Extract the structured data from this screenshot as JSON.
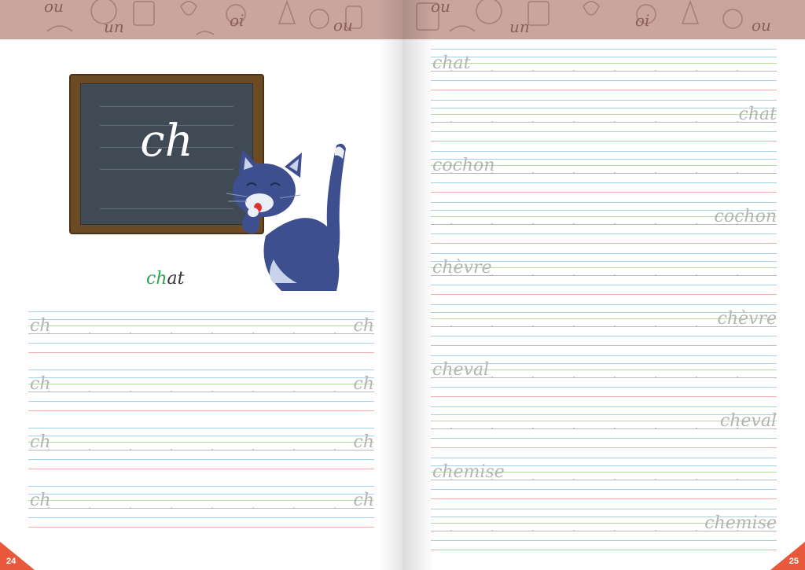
{
  "banner": {
    "words": [
      "ou",
      "un",
      "oi",
      "ou"
    ]
  },
  "left_page": {
    "page_number": "24",
    "board_letters": "ch",
    "caption": {
      "highlight": "ch",
      "rest": "at"
    },
    "practice_rows": [
      {
        "left": "ch",
        "right": "ch"
      },
      {
        "left": "ch",
        "right": "ch"
      },
      {
        "left": "ch",
        "right": "ch"
      },
      {
        "left": "ch",
        "right": "ch"
      }
    ]
  },
  "right_page": {
    "page_number": "25",
    "practice_rows": [
      {
        "word": "chat",
        "align": "left"
      },
      {
        "word": "chat",
        "align": "right"
      },
      {
        "word": "cochon",
        "align": "left"
      },
      {
        "word": "cochon",
        "align": "right"
      },
      {
        "word": "chèvre",
        "align": "left"
      },
      {
        "word": "chèvre",
        "align": "right"
      },
      {
        "word": "cheval",
        "align": "left"
      },
      {
        "word": "cheval",
        "align": "right"
      },
      {
        "word": "chemise",
        "align": "left"
      },
      {
        "word": "chemise",
        "align": "right"
      }
    ]
  },
  "colors": {
    "banner": "#c9a59e",
    "page_corner": "#e8583a",
    "highlight": "#2ea44f",
    "cat": "#3d4f8f"
  }
}
